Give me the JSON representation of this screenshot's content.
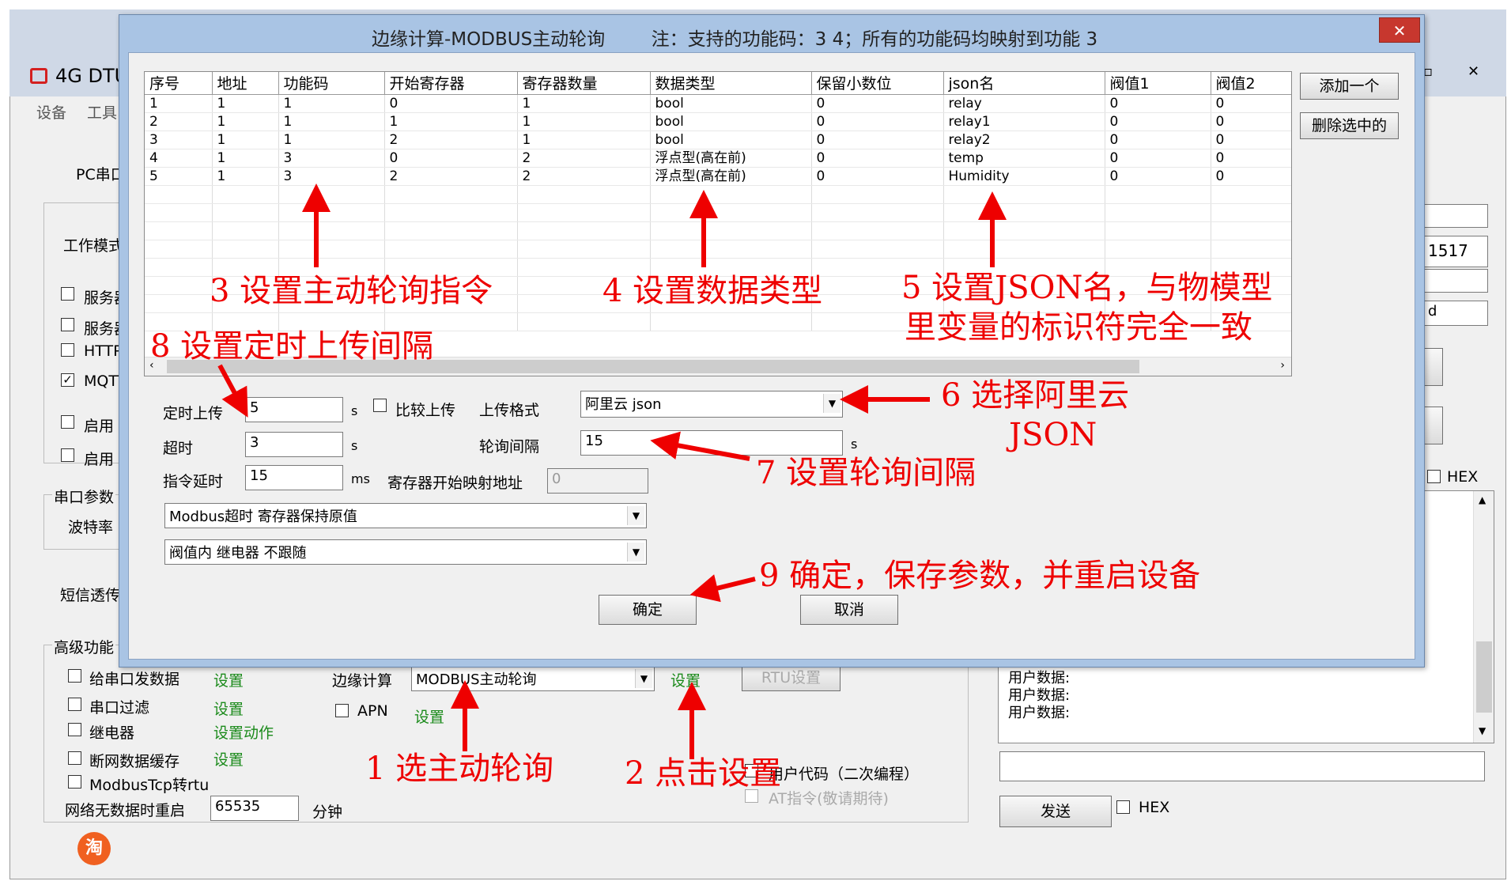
{
  "app": {
    "title_partial": "4G DTU",
    "menu": [
      "设备",
      "工具"
    ],
    "pc_port_label": "PC串口",
    "work_mode_label": "工作模式",
    "mode_options": [
      {
        "label": "服务器",
        "checked": false
      },
      {
        "label": "服务器",
        "checked": false
      },
      {
        "label": "HTTP",
        "checked": false
      },
      {
        "label": "MQTT",
        "checked": true
      },
      {
        "label": "启用",
        "checked": false
      },
      {
        "label": "启用",
        "checked": false
      }
    ],
    "serial_params_label": "串口参数",
    "baud_label": "波特率",
    "sms_label": "短信透传",
    "advanced_label": "高级功能",
    "right_value_1517": "1517",
    "right_value_d": "d",
    "hex_label": "HEX",
    "log_lines": [
      "用户数据:",
      "用户数据:",
      "用户数据:"
    ],
    "send_button": "发送"
  },
  "advanced": {
    "items": [
      {
        "label": "给串口发数据",
        "link": "设置"
      },
      {
        "label": "串口过滤",
        "link": "设置"
      },
      {
        "label": "继电器",
        "link": "设置动作"
      },
      {
        "label": "断网数据缓存",
        "link": "设置"
      },
      {
        "label": "ModbusTcp转rtu",
        "link": ""
      }
    ],
    "edge_calc_label": "边缘计算",
    "edge_calc_value": "MODBUS主动轮询",
    "edge_calc_setting": "设置",
    "rtu_setting": "RTU设置",
    "apn_label": "APN",
    "apn_setting": "设置",
    "user_code_label": "用户代码（二次编程）",
    "at_cmd_label": "AT指令(敬请期待)",
    "no_data_restart_label": "网络无数据时重启",
    "no_data_restart_value": "65535",
    "minute_label": "分钟",
    "taobao_icon": "淘"
  },
  "dialog": {
    "title": "边缘计算-MODBUS主动轮询        注：支持的功能码：3 4；所有的功能码均映射到功能 3",
    "close_glyph": "✕",
    "columns": [
      "序号",
      "地址",
      "功能码",
      "开始寄存器",
      "寄存器数量",
      "数据类型",
      "保留小数位",
      "json名",
      "阀值1",
      "阀值2"
    ],
    "rows": [
      [
        "1",
        "1",
        "1",
        "0",
        "1",
        "bool",
        "0",
        "relay",
        "0",
        "0"
      ],
      [
        "2",
        "1",
        "1",
        "1",
        "1",
        "bool",
        "0",
        "relay1",
        "0",
        "0"
      ],
      [
        "3",
        "1",
        "1",
        "2",
        "1",
        "bool",
        "0",
        "relay2",
        "0",
        "0"
      ],
      [
        "4",
        "1",
        "3",
        "0",
        "2",
        "浮点型(高在前)",
        "0",
        "temp",
        "0",
        "0"
      ],
      [
        "5",
        "1",
        "3",
        "2",
        "2",
        "浮点型(高在前)",
        "0",
        "Humidity",
        "0",
        "0"
      ]
    ],
    "add_button": "添加一个",
    "delete_button": "删除选中的",
    "timed_upload_label": "定时上传",
    "timed_upload_value": "5",
    "timed_upload_unit": "s",
    "compare_upload_label": "比较上传",
    "upload_format_label": "上传格式",
    "upload_format_value": "阿里云 json",
    "timeout_label": "超时",
    "timeout_value": "3",
    "timeout_unit": "s",
    "poll_interval_label": "轮询间隔",
    "poll_interval_value": "15",
    "poll_interval_unit": "s",
    "cmd_delay_label": "指令延时",
    "cmd_delay_value": "15",
    "cmd_delay_unit": "ms",
    "reg_map_label": "寄存器开始映射地址",
    "reg_map_value": "0",
    "timeout_policy_value": "Modbus超时 寄存器保持原值",
    "threshold_policy_value": "阀值内 继电器 不跟随",
    "ok_button": "确定",
    "cancel_button": "取消"
  },
  "annotations": {
    "a1": "1  选主动轮询",
    "a2": "2  点击设置",
    "a3": "3  设置主动轮询指令",
    "a4": "4  设置数据类型",
    "a5_line1": "5  设置JSON名，与物模型",
    "a5_line2": "里变量的标识符完全一致",
    "a6_line1": "6  选择阿里云",
    "a6_line2": "JSON",
    "a7": "7  设置轮询间隔",
    "a8": "8  设置定时上传间隔",
    "a9": "9  确定，保存参数，并重启设备",
    "color": "#ee0000"
  }
}
